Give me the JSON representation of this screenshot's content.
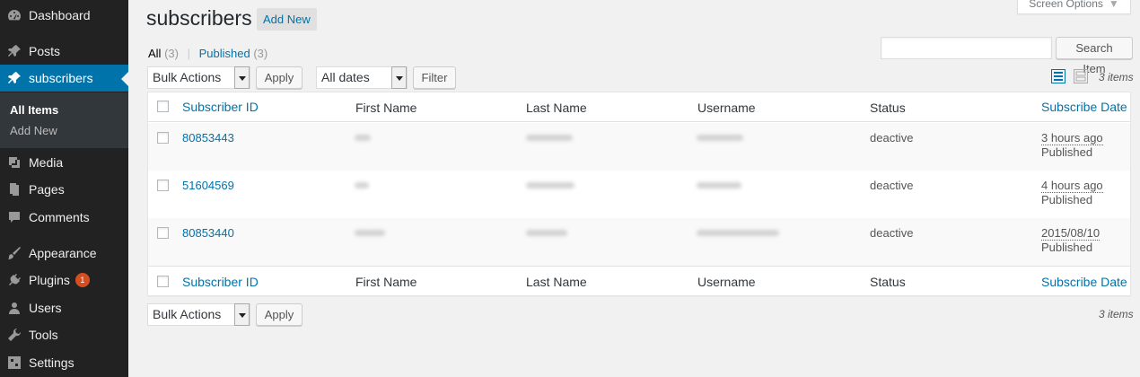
{
  "sidebar": {
    "items": [
      {
        "label": "Dashboard",
        "icon": "dashboard-icon"
      },
      {
        "label": "Posts",
        "icon": "pin-icon"
      },
      {
        "label": "subscribers",
        "icon": "pin-icon"
      },
      {
        "label": "Media",
        "icon": "media-icon"
      },
      {
        "label": "Pages",
        "icon": "pages-icon"
      },
      {
        "label": "Comments",
        "icon": "comments-icon"
      },
      {
        "label": "Appearance",
        "icon": "brush-icon"
      },
      {
        "label": "Plugins",
        "icon": "plugin-icon",
        "badge": "1"
      },
      {
        "label": "Users",
        "icon": "user-icon"
      },
      {
        "label": "Tools",
        "icon": "wrench-icon"
      },
      {
        "label": "Settings",
        "icon": "settings-icon"
      }
    ],
    "submenu": {
      "all_items": "All Items",
      "add_new": "Add New"
    }
  },
  "header": {
    "title": "subscribers",
    "add_new": "Add New",
    "screen_options": "Screen Options"
  },
  "filters": {
    "all_label": "All",
    "all_count": "(3)",
    "published_label": "Published",
    "published_count": "(3)"
  },
  "search": {
    "placeholder": "",
    "button": "Search Item"
  },
  "bulk": {
    "label": "Bulk Actions",
    "apply": "Apply"
  },
  "date_filter": {
    "label": "All dates",
    "filter_button": "Filter"
  },
  "items_count": "3 items",
  "accent": "#0073aa",
  "table": {
    "columns": [
      "Subscriber ID",
      "First Name",
      "Last Name",
      "Username",
      "Status",
      "Subscribe Date"
    ],
    "rows": [
      {
        "id": "80853443",
        "status": "deactive",
        "date": "3 hours ago",
        "state": "Published"
      },
      {
        "id": "51604569",
        "status": "deactive",
        "date": "4 hours ago",
        "state": "Published"
      },
      {
        "id": "80853440",
        "status": "deactive",
        "date": "2015/08/10",
        "state": "Published"
      }
    ]
  }
}
